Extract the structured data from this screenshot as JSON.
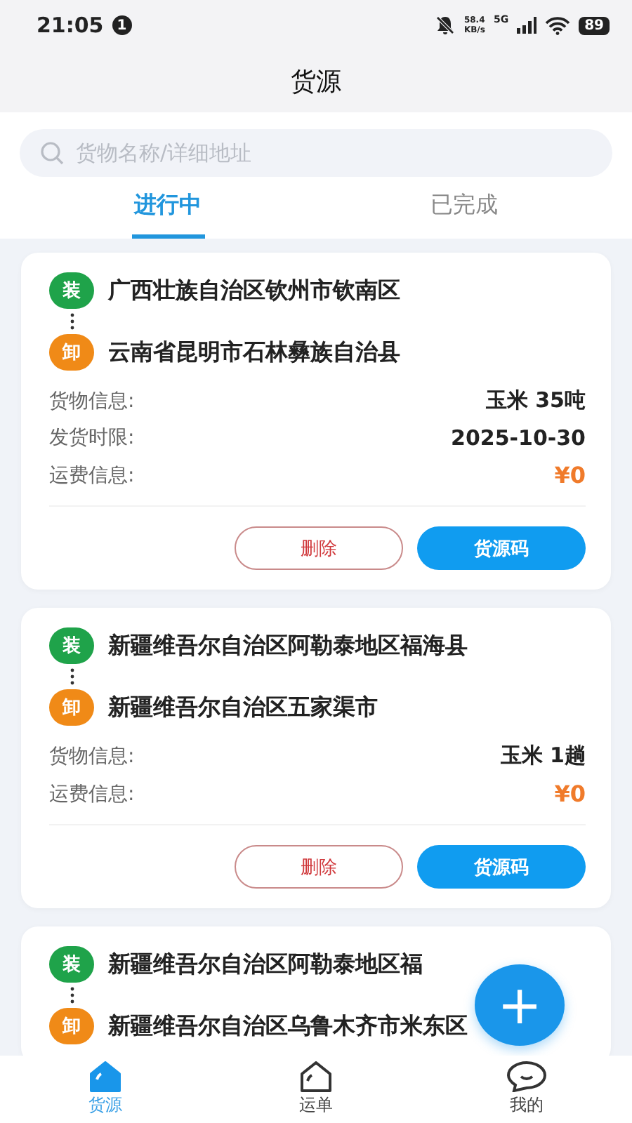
{
  "status_bar": {
    "time": "21:05",
    "notification_count": "1",
    "net_speed": "58.4",
    "net_unit": "KB/s",
    "network": "5G",
    "battery": "89"
  },
  "header": {
    "title": "货源"
  },
  "search": {
    "placeholder": "货物名称/详细地址"
  },
  "tabs": [
    {
      "label": "进行中",
      "selected": true
    },
    {
      "label": "已完成",
      "selected": false
    }
  ],
  "cards": [
    {
      "load_badge": "装",
      "load": "广西壮族自治区钦州市钦南区",
      "unload_badge": "卸",
      "unload": "云南省昆明市石林彝族自治县",
      "info": [
        {
          "label": "货物信息:",
          "value": "玉米 35吨",
          "kind": "text"
        },
        {
          "label": "发货时限:",
          "value": "2025-10-30",
          "kind": "text"
        },
        {
          "label": "运费信息:",
          "value": "¥0",
          "kind": "price"
        }
      ],
      "buttons": [
        {
          "label": "删除",
          "kind": "outline"
        },
        {
          "label": "货源码",
          "kind": "primary"
        }
      ]
    },
    {
      "load_badge": "装",
      "load": "新疆维吾尔自治区阿勒泰地区福海县",
      "unload_badge": "卸",
      "unload": "新疆维吾尔自治区五家渠市",
      "info": [
        {
          "label": "货物信息:",
          "value": "玉米 1趟",
          "kind": "text"
        },
        {
          "label": "运费信息:",
          "value": "¥0",
          "kind": "price"
        }
      ],
      "buttons": [
        {
          "label": "删除",
          "kind": "outline"
        },
        {
          "label": "货源码",
          "kind": "primary"
        }
      ]
    },
    {
      "load_badge": "装",
      "load": "新疆维吾尔自治区阿勒泰地区福",
      "unload_badge": "卸",
      "unload": "新疆维吾尔自治区乌鲁木齐市米东区"
    }
  ],
  "fab": {
    "label": "+"
  },
  "bottom_nav": [
    {
      "label": "货源",
      "kind": "home",
      "selected": true
    },
    {
      "label": "运单",
      "kind": "house",
      "selected": false
    },
    {
      "label": "我的",
      "kind": "chat",
      "selected": false
    }
  ]
}
